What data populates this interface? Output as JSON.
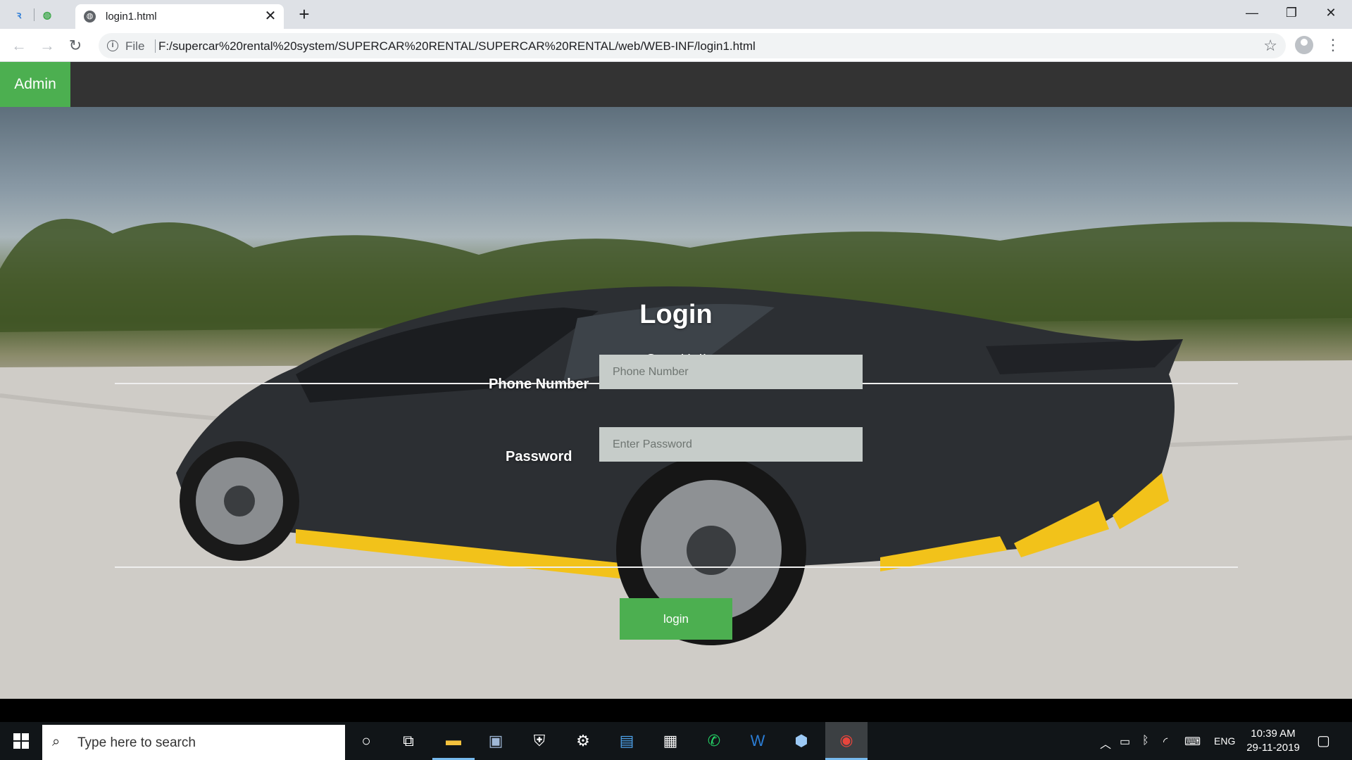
{
  "browser": {
    "tab_title": "login1.html",
    "tab_close": "✕",
    "new_tab": "+",
    "file_label": "File",
    "url": "F:/supercar%20rental%20system/SUPERCAR%20RENTAL/SUPERCAR%20RENTAL/web/WEB-INF/login1.html",
    "window_minimize": "—",
    "window_restore": "❐",
    "window_close": "✕"
  },
  "navbar": {
    "admin_label": "Admin"
  },
  "login": {
    "title": "Login",
    "subtitle": "Gear Up!!",
    "phone_label": "Phone Number",
    "phone_placeholder": "Phone Number",
    "password_label": "Password",
    "password_placeholder": "Enter Password",
    "submit_label": "login"
  },
  "taskbar": {
    "search_placeholder": "Type here to search",
    "language": "ENG",
    "time": "10:39 AM",
    "date": "29-11-2019"
  },
  "colors": {
    "accent_green": "#4caf50",
    "navbar": "#333333",
    "taskbar": "#111518"
  },
  "icons": [
    "back-icon",
    "forward-icon",
    "reload-icon",
    "info-icon",
    "star-icon",
    "profile-icon",
    "menu-icon",
    "windows-start-icon",
    "search-icon",
    "cortana-icon",
    "task-view-icon",
    "file-explorer-icon",
    "photos-icon",
    "defender-icon",
    "settings-icon",
    "outlook-icon",
    "store-icon",
    "whatsapp-icon",
    "word-icon",
    "box-icon",
    "chrome-icon"
  ]
}
